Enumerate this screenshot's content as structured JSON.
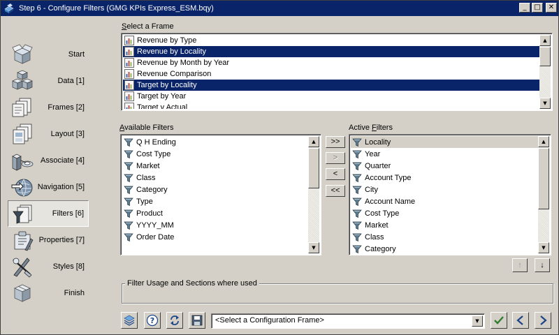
{
  "window": {
    "title": "Step 6 - Configure Filters (GMG KPIs Express_ESM.bqy)",
    "minimize_glyph": "_",
    "maximize_glyph": "□",
    "close_glyph": "✕"
  },
  "nav": {
    "items": [
      {
        "label": "Start",
        "icon": "start-box-icon"
      },
      {
        "label": "Data [1]",
        "icon": "data-cubes-icon"
      },
      {
        "label": "Frames [2]",
        "icon": "frames-icon"
      },
      {
        "label": "Layout [3]",
        "icon": "layout-icon"
      },
      {
        "label": "Associate [4]",
        "icon": "associate-icon"
      },
      {
        "label": "Navigation [5]",
        "icon": "navigation-icon"
      },
      {
        "label": "Filters [6]",
        "icon": "filters-icon",
        "active": true
      },
      {
        "label": "Properties [7]",
        "icon": "properties-icon"
      },
      {
        "label": "Styles [8]",
        "icon": "styles-icon"
      },
      {
        "label": "Finish",
        "icon": "finish-box-icon"
      }
    ]
  },
  "frame_select": {
    "label_pre": "",
    "label_key": "S",
    "label_post": "elect a Frame",
    "items": [
      {
        "label": "Revenue by Type",
        "selected": false
      },
      {
        "label": "Revenue by Locality",
        "selected": true
      },
      {
        "label": "Revenue by Month by Year",
        "selected": false
      },
      {
        "label": "Revenue Comparison",
        "selected": false
      },
      {
        "label": "Target by Locality",
        "selected": true
      },
      {
        "label": "Target by Year",
        "selected": false
      },
      {
        "label": "Target v Actual",
        "selected": false
      }
    ]
  },
  "available_filters": {
    "label_pre": "",
    "label_key": "A",
    "label_post": "vailable Filters",
    "items": [
      "Q H Ending",
      "Cost Type",
      "Market",
      "Class",
      "Category",
      "Type",
      "Product",
      "YYYY_MM",
      "Order Date"
    ]
  },
  "active_filters": {
    "label_pre": "Active ",
    "label_key": "F",
    "label_post": "ilters",
    "focused_index": 0,
    "items": [
      "Locality",
      "Year",
      "Quarter",
      "Account Type",
      "City",
      "Account Name",
      "Cost Type",
      "Market",
      "Class",
      "Category"
    ]
  },
  "transfer_buttons": {
    "add_all": ">>",
    "add": ">",
    "remove": "<",
    "remove_all": "<<"
  },
  "order_buttons": {
    "move_up": "↑",
    "move_down": "↓"
  },
  "usage_group": {
    "caption": "Filter Usage and Sections where used"
  },
  "bottom": {
    "config_frame_value": "<Select a Configuration Frame>"
  },
  "colors": {
    "selection": "#0a246a",
    "titlebar": "#0a246a",
    "face": "#d4d0c8"
  }
}
